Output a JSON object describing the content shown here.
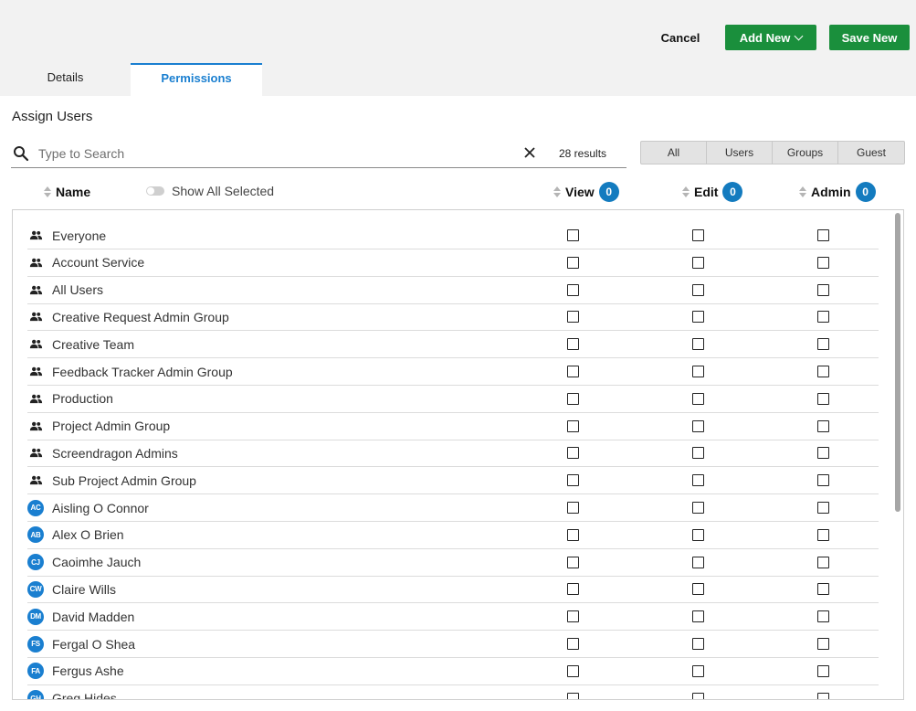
{
  "toolbar": {
    "cancel_label": "Cancel",
    "add_new_label": "Add New",
    "save_new_label": "Save New"
  },
  "tabs": [
    {
      "label": "Details",
      "active": false
    },
    {
      "label": "Permissions",
      "active": true
    }
  ],
  "section_title": "Assign Users",
  "search": {
    "placeholder": "Type to Search",
    "value": "",
    "results_text": "28 results"
  },
  "filters": [
    "All",
    "Users",
    "Groups",
    "Guest"
  ],
  "columns": {
    "name_label": "Name",
    "show_all_selected_label": "Show All Selected",
    "view": {
      "label": "View",
      "count": "0"
    },
    "edit": {
      "label": "Edit",
      "count": "0"
    },
    "admin": {
      "label": "Admin",
      "count": "0"
    }
  },
  "colors": {
    "accent": "#1a7fd0",
    "primary_button": "#1a8f3c",
    "badge": "#137bbf"
  },
  "rows": [
    {
      "type": "group",
      "icon": "group-icon",
      "name": "Everyone",
      "view": false,
      "edit": false,
      "admin": false
    },
    {
      "type": "group",
      "icon": "group-icon",
      "name": "Account Service",
      "view": false,
      "edit": false,
      "admin": false
    },
    {
      "type": "group",
      "icon": "group-icon",
      "name": "All Users",
      "view": false,
      "edit": false,
      "admin": false
    },
    {
      "type": "group",
      "icon": "group-icon",
      "name": "Creative Request Admin Group",
      "view": false,
      "edit": false,
      "admin": false
    },
    {
      "type": "group",
      "icon": "group-icon",
      "name": "Creative Team",
      "view": false,
      "edit": false,
      "admin": false
    },
    {
      "type": "group",
      "icon": "group-icon",
      "name": "Feedback Tracker Admin Group",
      "view": false,
      "edit": false,
      "admin": false
    },
    {
      "type": "group",
      "icon": "group-icon",
      "name": "Production",
      "view": false,
      "edit": false,
      "admin": false
    },
    {
      "type": "group",
      "icon": "group-icon",
      "name": "Project Admin Group",
      "view": false,
      "edit": false,
      "admin": false
    },
    {
      "type": "group",
      "icon": "group-icon",
      "name": "Screendragon Admins",
      "view": false,
      "edit": false,
      "admin": false
    },
    {
      "type": "group",
      "icon": "group-icon",
      "name": "Sub Project Admin Group",
      "view": false,
      "edit": false,
      "admin": false
    },
    {
      "type": "user",
      "initials": "AC",
      "name": "Aisling O Connor",
      "view": false,
      "edit": false,
      "admin": false
    },
    {
      "type": "user",
      "initials": "AB",
      "name": "Alex O Brien",
      "view": false,
      "edit": false,
      "admin": false
    },
    {
      "type": "user",
      "initials": "CJ",
      "name": "Caoimhe Jauch",
      "view": false,
      "edit": false,
      "admin": false
    },
    {
      "type": "user",
      "initials": "CW",
      "name": "Claire Wills",
      "view": false,
      "edit": false,
      "admin": false
    },
    {
      "type": "user",
      "initials": "DM",
      "name": "David Madden",
      "view": false,
      "edit": false,
      "admin": false
    },
    {
      "type": "user",
      "initials": "FS",
      "name": "Fergal O Shea",
      "view": false,
      "edit": false,
      "admin": false
    },
    {
      "type": "user",
      "initials": "FA",
      "name": "Fergus Ashe",
      "view": false,
      "edit": false,
      "admin": false
    },
    {
      "type": "user",
      "initials": "GH",
      "name": "Greg Hides",
      "view": false,
      "edit": false,
      "admin": false
    }
  ]
}
